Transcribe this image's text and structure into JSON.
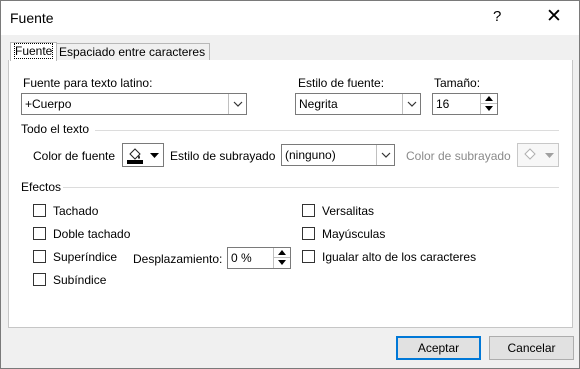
{
  "window": {
    "title": "Fuente",
    "help_glyph": "?",
    "close_glyph": "✕"
  },
  "tabs": [
    {
      "label": "Fuente",
      "active": true
    },
    {
      "label": "Espaciado entre caracteres",
      "active": false
    }
  ],
  "font": {
    "latin_label": "Fuente para texto latino:",
    "latin_value": "+Cuerpo",
    "style_label": "Estilo de fuente:",
    "style_value": "Negrita",
    "size_label": "Tamaño:",
    "size_value": "16"
  },
  "all_text": {
    "section_label": "Todo el texto",
    "font_color_label": "Color de fuente",
    "underline_style_label": "Estilo de subrayado",
    "underline_style_value": "(ninguno)",
    "underline_color_label": "Color de subrayado",
    "font_color_swatch": "#000000"
  },
  "effects": {
    "section_label": "Efectos",
    "strikethrough": "Tachado",
    "double_strikethrough": "Doble tachado",
    "superscript": "Superíndice",
    "offset_label": "Desplazamiento:",
    "offset_value": "0 %",
    "subscript": "Subíndice",
    "small_caps": "Versalitas",
    "all_caps": "Mayúsculas",
    "equalize_height": "Igualar alto de los caracteres"
  },
  "buttons": {
    "ok": "Aceptar",
    "cancel": "Cancelar"
  },
  "colors": {
    "accent": "#0078d7",
    "dialog_bg": "#f0f0f0"
  }
}
